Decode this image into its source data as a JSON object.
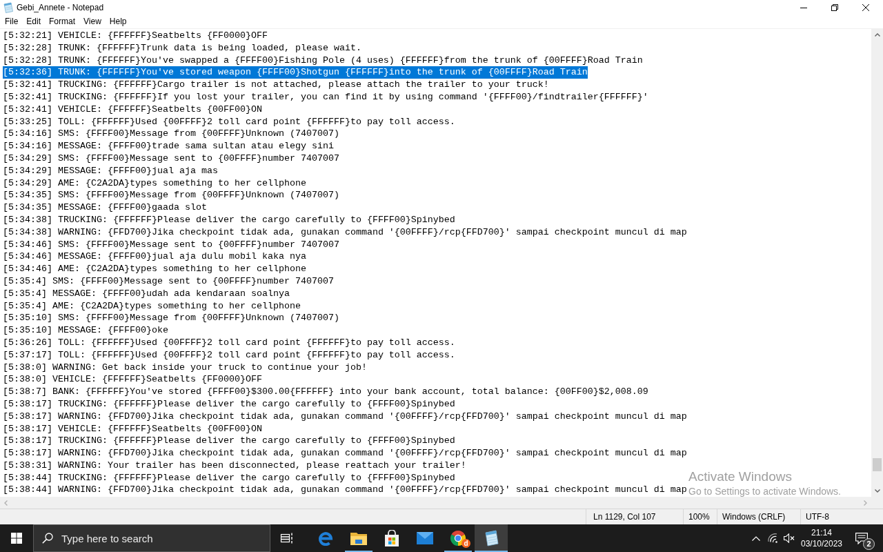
{
  "window": {
    "title": "Gebi_Annete - Notepad"
  },
  "menu": [
    "File",
    "Edit",
    "Format",
    "View",
    "Help"
  ],
  "editor": {
    "lines": [
      {
        "text": "[5:32:21] VEHICLE: {FFFFFF}Seatbelts {FF0000}OFF",
        "selected": false
      },
      {
        "text": "[5:32:28] TRUNK: {FFFFFF}Trunk data is being loaded, please wait.",
        "selected": false
      },
      {
        "text": "[5:32:28] TRUNK: {FFFFFF}You've swapped a {FFFF00}Fishing Pole (4 uses) {FFFFFF}from the trunk of {00FFFF}Road Train",
        "selected": false
      },
      {
        "text": "[5:32:36] TRUNK: {FFFFFF}You've stored weapon {FFFF00}Shotgun {FFFFFF}into the trunk of {00FFFF}Road Train",
        "selected": true
      },
      {
        "text": "[5:32:41] TRUCKING: {FFFFFF}Cargo trailer is not attached, please attach the trailer to your truck!",
        "selected": false
      },
      {
        "text": "[5:32:41] TRUCKING: {FFFFFF}If you lost your trailer, you can find it by using command '{FFFF00}/findtrailer{FFFFFF}'",
        "selected": false
      },
      {
        "text": "[5:32:41] VEHICLE: {FFFFFF}Seatbelts {00FF00}ON",
        "selected": false
      },
      {
        "text": "[5:33:25] TOLL: {FFFFFF}Used {00FFFF}2 toll card point {FFFFFF}to pay toll access.",
        "selected": false
      },
      {
        "text": "[5:34:16] SMS: {FFFF00}Message from {00FFFF}Unknown (7407007)",
        "selected": false
      },
      {
        "text": "[5:34:16] MESSAGE: {FFFF00}trade sama sultan atau elegy sini",
        "selected": false
      },
      {
        "text": "[5:34:29] SMS: {FFFF00}Message sent to {00FFFF}number 7407007",
        "selected": false
      },
      {
        "text": "[5:34:29] MESSAGE: {FFFF00}jual aja mas",
        "selected": false
      },
      {
        "text": "[5:34:29] AME: {C2A2DA}types something to her cellphone",
        "selected": false
      },
      {
        "text": "[5:34:35] SMS: {FFFF00}Message from {00FFFF}Unknown (7407007)",
        "selected": false
      },
      {
        "text": "[5:34:35] MESSAGE: {FFFF00}gaada slot",
        "selected": false
      },
      {
        "text": "[5:34:38] TRUCKING: {FFFFFF}Please deliver the cargo carefully to {FFFF00}Spinybed",
        "selected": false
      },
      {
        "text": "[5:34:38] WARNING: {FFD700}Jika checkpoint tidak ada, gunakan command '{00FFFF}/rcp{FFD700}' sampai checkpoint muncul di map",
        "selected": false
      },
      {
        "text": "[5:34:46] SMS: {FFFF00}Message sent to {00FFFF}number 7407007",
        "selected": false
      },
      {
        "text": "[5:34:46] MESSAGE: {FFFF00}jual aja dulu mobil kaka nya",
        "selected": false
      },
      {
        "text": "[5:34:46] AME: {C2A2DA}types something to her cellphone",
        "selected": false
      },
      {
        "text": "[5:35:4] SMS: {FFFF00}Message sent to {00FFFF}number 7407007",
        "selected": false
      },
      {
        "text": "[5:35:4] MESSAGE: {FFFF00}udah ada kendaraan soalnya",
        "selected": false
      },
      {
        "text": "[5:35:4] AME: {C2A2DA}types something to her cellphone",
        "selected": false
      },
      {
        "text": "[5:35:10] SMS: {FFFF00}Message from {00FFFF}Unknown (7407007)",
        "selected": false
      },
      {
        "text": "[5:35:10] MESSAGE: {FFFF00}oke",
        "selected": false
      },
      {
        "text": "[5:36:26] TOLL: {FFFFFF}Used {00FFFF}2 toll card point {FFFFFF}to pay toll access.",
        "selected": false
      },
      {
        "text": "[5:37:17] TOLL: {FFFFFF}Used {00FFFF}2 toll card point {FFFFFF}to pay toll access.",
        "selected": false
      },
      {
        "text": "[5:38:0] WARNING: Get back inside your truck to continue your job!",
        "selected": false
      },
      {
        "text": "[5:38:0] VEHICLE: {FFFFFF}Seatbelts {FF0000}OFF",
        "selected": false
      },
      {
        "text": "[5:38:7] BANK: {FFFFFF}You've stored {FFFF00}$300.00{FFFFFF} into your bank account, total balance: {00FF00}$2,008.09",
        "selected": false
      },
      {
        "text": "[5:38:17] TRUCKING: {FFFFFF}Please deliver the cargo carefully to {FFFF00}Spinybed",
        "selected": false
      },
      {
        "text": "[5:38:17] WARNING: {FFD700}Jika checkpoint tidak ada, gunakan command '{00FFFF}/rcp{FFD700}' sampai checkpoint muncul di map",
        "selected": false
      },
      {
        "text": "[5:38:17] VEHICLE: {FFFFFF}Seatbelts {00FF00}ON",
        "selected": false
      },
      {
        "text": "[5:38:17] TRUCKING: {FFFFFF}Please deliver the cargo carefully to {FFFF00}Spinybed",
        "selected": false
      },
      {
        "text": "[5:38:17] WARNING: {FFD700}Jika checkpoint tidak ada, gunakan command '{00FFFF}/rcp{FFD700}' sampai checkpoint muncul di map",
        "selected": false
      },
      {
        "text": "[5:38:31] WARNING: Your trailer has been disconnected, please reattach your trailer!",
        "selected": false
      },
      {
        "text": "[5:38:44] TRUCKING: {FFFFFF}Please deliver the cargo carefully to {FFFF00}Spinybed",
        "selected": false
      },
      {
        "text": "[5:38:44] WARNING: {FFD700}Jika checkpoint tidak ada, gunakan command '{00FFFF}/rcp{FFD700}' sampai checkpoint muncul di map",
        "selected": false
      }
    ]
  },
  "activation_notice": {
    "title": "Activate Windows",
    "text": "Go to Settings to activate Windows."
  },
  "status_bar": {
    "position": "Ln 1129, Col 107",
    "zoom": "100%",
    "line_ending": "Windows (CRLF)",
    "encoding": "UTF-8"
  },
  "taskbar": {
    "search": {
      "placeholder": "Type here to search"
    },
    "apps": [
      {
        "kind": "edge",
        "running": false,
        "active": false
      },
      {
        "kind": "explorer",
        "running": true,
        "active": false
      },
      {
        "kind": "store",
        "running": false,
        "active": false
      },
      {
        "kind": "mail",
        "running": false,
        "active": false
      },
      {
        "kind": "chrome",
        "running": true,
        "active": false,
        "badge": "d"
      },
      {
        "kind": "notepad",
        "running": true,
        "active": true
      }
    ],
    "clock": {
      "time": "21:14",
      "date": "03/10/2023"
    },
    "notifications": {
      "count": "2"
    }
  }
}
